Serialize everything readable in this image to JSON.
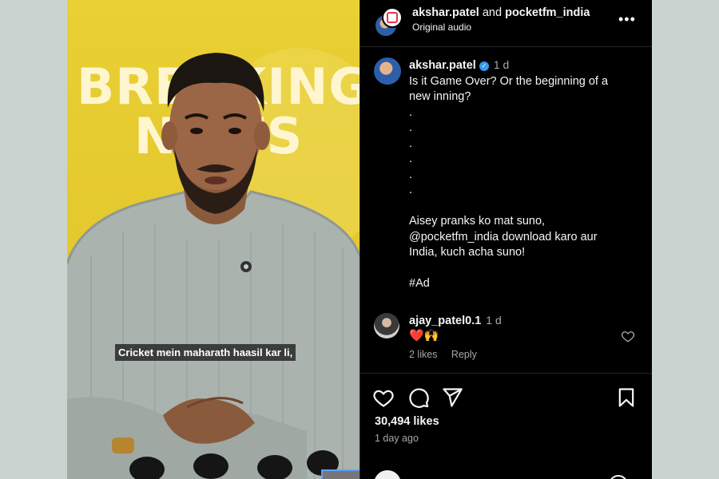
{
  "media": {
    "headline_line1": "BREAKING",
    "headline_line2": "NEWS",
    "subtitle": "Cricket mein maharath haasil kar li,"
  },
  "header": {
    "user1": "akshar.patel",
    "joiner": "and",
    "user2": "pocketfm_india",
    "audio": "Original audio",
    "more_label": "•••"
  },
  "caption": {
    "username": "akshar.patel",
    "time": "1 d",
    "lines": [
      "Is it Game Over? Or the beginning of a",
      "new inning?",
      ".",
      ".",
      ".",
      ".",
      ".",
      ".",
      "",
      "Aisey pranks ko mat suno,",
      "@pocketfm_india download karo aur",
      "India, kuch acha suno!",
      "",
      "#Ad"
    ]
  },
  "comment": {
    "username": "ajay_patel0.1",
    "time": "1 d",
    "text": "❤️🙌",
    "likes": "2 likes",
    "reply": "Reply"
  },
  "post": {
    "likes": "30,494 likes",
    "time_ago": "1 day ago"
  },
  "colors": {
    "background": "#000000",
    "verified": "#3897f0",
    "secondary_text": "#a8a8a8",
    "media_yellow": "#e4c82e"
  }
}
